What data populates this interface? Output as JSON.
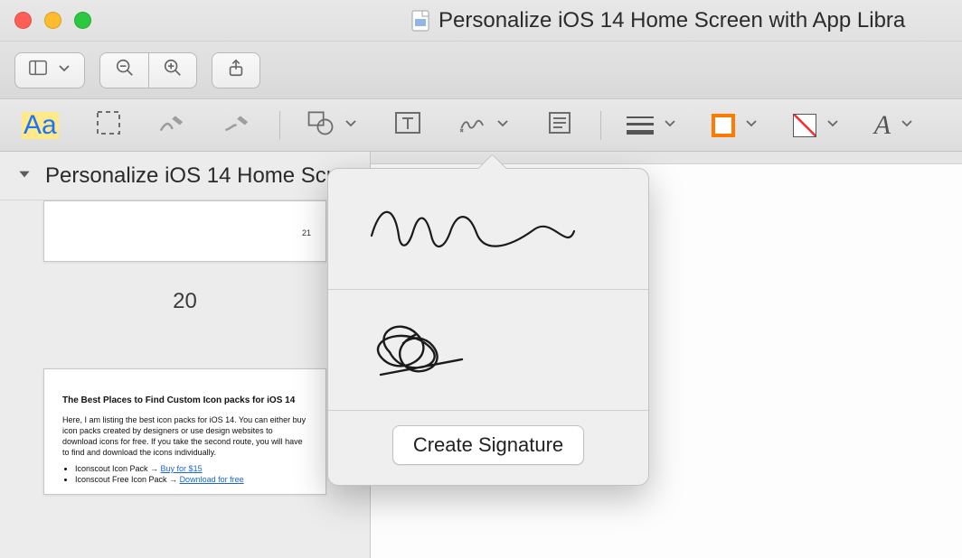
{
  "window": {
    "title": "Personalize iOS 14 Home Screen with App Libra"
  },
  "toolbar": {
    "sidebar_toggle_label": "Sidebar",
    "zoom_out_label": "Zoom Out",
    "zoom_in_label": "Zoom In",
    "share_label": "Share"
  },
  "annotation_toolbar": {
    "highlight_sample": "Aa",
    "text_select_label": "Text Selection",
    "sketch_label": "Sketch",
    "draw_label": "Draw",
    "shapes_label": "Shapes",
    "textbox_label": "Text",
    "sign_label": "Sign",
    "note_label": "Note",
    "line_style_label": "Line Style",
    "border_color_label": "Border Color",
    "fill_color_label": "Fill Color",
    "text_style_label": "Text Style"
  },
  "sidebar": {
    "doc_title": "Personalize iOS 14 Home Scre",
    "current_page_label": "20",
    "thumb_tiny_page": "21",
    "thumb_article": {
      "heading": "The Best Places to Find Custom Icon packs for iOS 14",
      "body": "Here, I am listing the best icon packs for iOS 14. You can either buy icon packs created by designers or use design websites to download icons for free. If you take the second route, you will have to find and download the icons individually.",
      "link1_prefix": "Iconscout Icon Pack → ",
      "link1_text": "Buy for $15",
      "link2_prefix": "Iconscout Free Icon Pack → ",
      "link2_text": "Download for free"
    }
  },
  "signature_popover": {
    "signature1_name": "signature-1",
    "signature2_name": "signature-2",
    "create_button_label": "Create Signature"
  }
}
